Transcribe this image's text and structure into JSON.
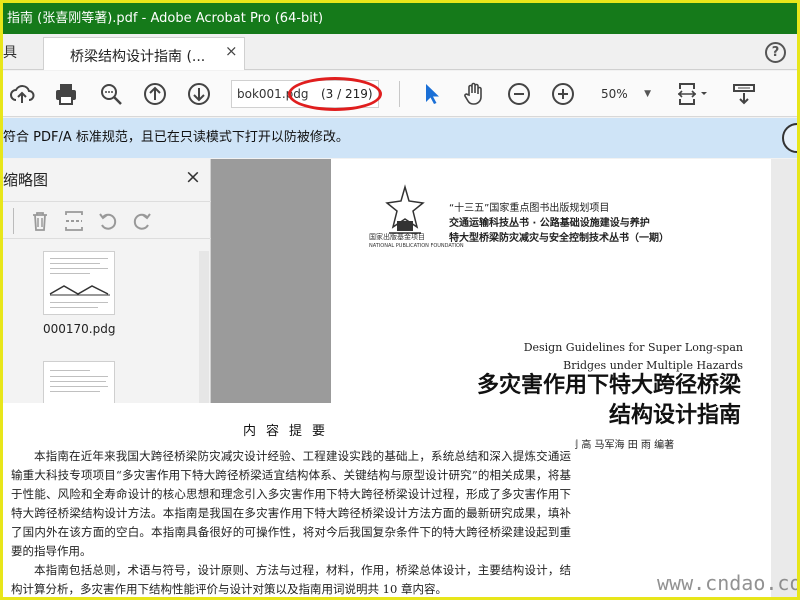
{
  "titlebar": {
    "title": "指南 (张喜刚等著).pdf - Adobe Acrobat Pro (64-bit)"
  },
  "tabs": {
    "tools_partial": "具",
    "doc_tab": "桥梁结构设计指南 (...",
    "close": "×",
    "help": "?"
  },
  "toolbar": {
    "filename": "bok001.pdg",
    "page_indicator": "(3 / 219)",
    "zoom": "50%"
  },
  "notice": {
    "text": "符合 PDF/A 标准规范，且已在只读模式下打开以防被修改。"
  },
  "left_panel": {
    "title": "缩略图",
    "close": "×",
    "thumbnail_label": "000170.pdg"
  },
  "page": {
    "project_line1": "“十三五”国家重点图书出版规划项目",
    "project_line2": "交通运输科技丛书 · 公路基础设施建设与养护",
    "project_line3": "特大型桥梁防灾减灾与安全控制技术丛书（一期）",
    "logo_text1": "国家出版基金项目",
    "logo_text2": "NATIONAL PUBLICATION FOUNDATION",
    "en_title_line1": "Design Guidelines for Super Long-span",
    "en_title_line2": "Bridges under Multiple Hazards",
    "cn_title_line1": "多灾害作用下特大跨径桥梁",
    "cn_title_line2": "结构设计指南",
    "authors": "张喜刚  刘 高  马军海  田 雨  编著"
  },
  "overlay": {
    "heading": "内容提要",
    "para1": "本指南在近年来我国大跨径桥梁防灾减灾设计经验、工程建设实践的基础上，系统总结和深入提炼交通运输重大科技专项项目“多灾害作用下特大跨径桥梁适宜结构体系、关键结构与原型设计研究”的相关成果，将基于性能、风险和全寿命设计的核心思想和理念引入多灾害作用下特大跨径桥梁设计过程，形成了多灾害作用下特大跨径桥梁结构设计方法。本指南是我国在多灾害作用下特大跨径桥梁设计方法方面的最新研究成果，填补了国内外在该方面的空白。本指南具备很好的可操作性，将对今后我国复杂条件下的特大跨径桥梁建设起到重要的指导作用。",
    "para2": "本指南包括总则，术语与符号，设计原则、方法与过程，材料，作用，桥梁总体设计，主要结构设计，结构计算分析，多灾害作用下结构性能评价与设计对策以及指南用词说明共 10 章内容。"
  },
  "watermark": "www.cndao.com",
  "colors": {
    "titlebar": "#157a1a",
    "notice_bg": "#cfe4f7",
    "highlight_ellipse": "#e01e1e",
    "cursor": "#1a6fd6"
  }
}
